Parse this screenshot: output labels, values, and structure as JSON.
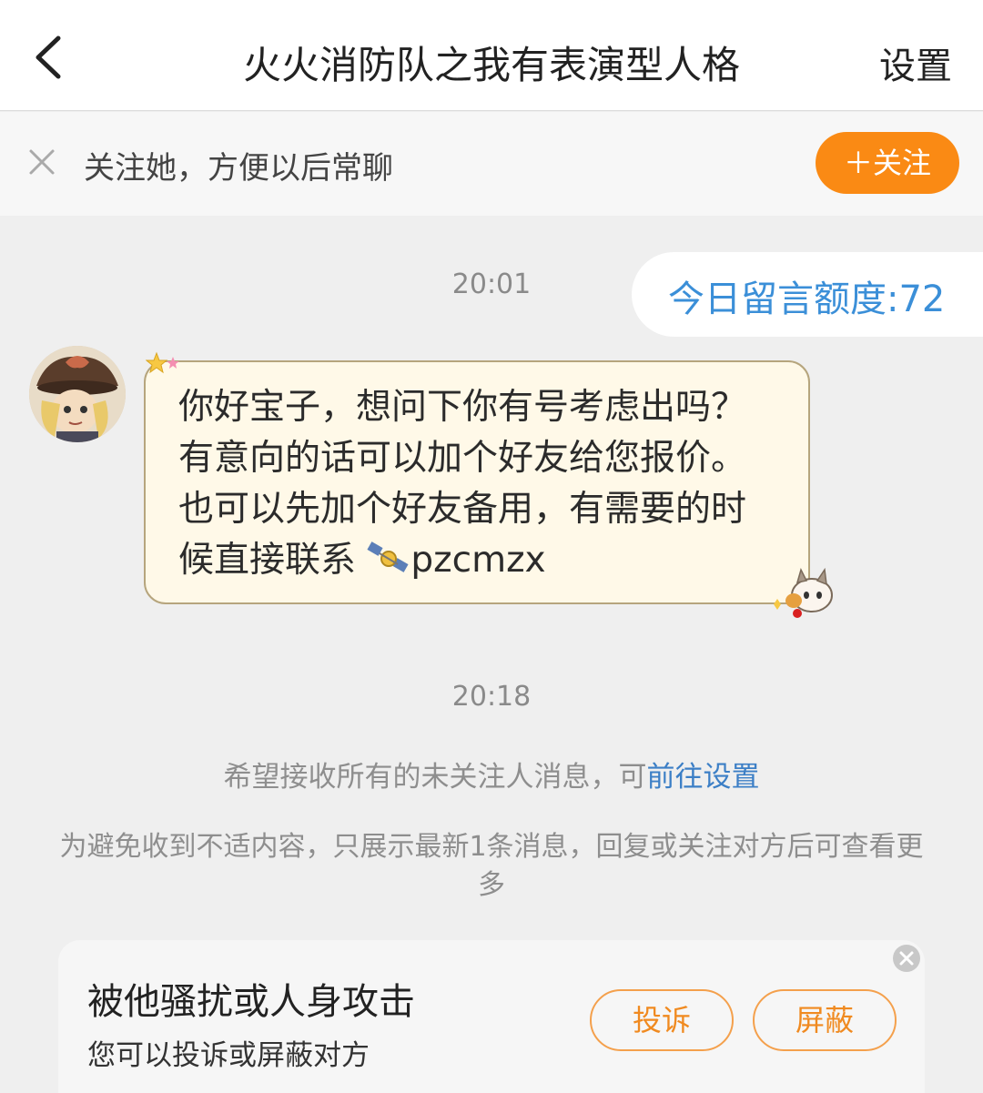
{
  "header": {
    "title": "火火消防队之我有表演型人格",
    "settings_label": "设置",
    "back_icon": "chevron-left-icon"
  },
  "follow_bar": {
    "prompt": "关注她，方便以后常聊",
    "follow_button": "＋关注",
    "close_icon": "close-icon"
  },
  "messages": {
    "time1": "20:01",
    "quota_label": "今日留言额度:72",
    "incoming_text": "你好宝子，想问下你有号考虑出吗？有意向的话可以加个好友给您报价。也可以先加个好友备用，有需要的时候直接联系 ",
    "incoming_id": "pzcmzx",
    "inline_icon": "satellite-icon",
    "time2": "20:18"
  },
  "notices": {
    "settings_notice": "希望接收所有的未关注人消息，可",
    "settings_link": "前往设置",
    "filter_notice": "为避免收到不适内容，只展示最新1条消息，回复或关注对方后可查看更多"
  },
  "report_card": {
    "title": "被他骚扰或人身攻击",
    "subtitle": "您可以投诉或屏蔽对方",
    "report_button": "投诉",
    "block_button": "屏蔽",
    "close_icon": "close-circle-icon"
  },
  "colors": {
    "accent_orange": "#fa8a14",
    "link_blue": "#3c7fc6",
    "quota_blue": "#3b8fd8",
    "bubble_bg": "#fff9e8",
    "page_bg": "#efefef"
  }
}
